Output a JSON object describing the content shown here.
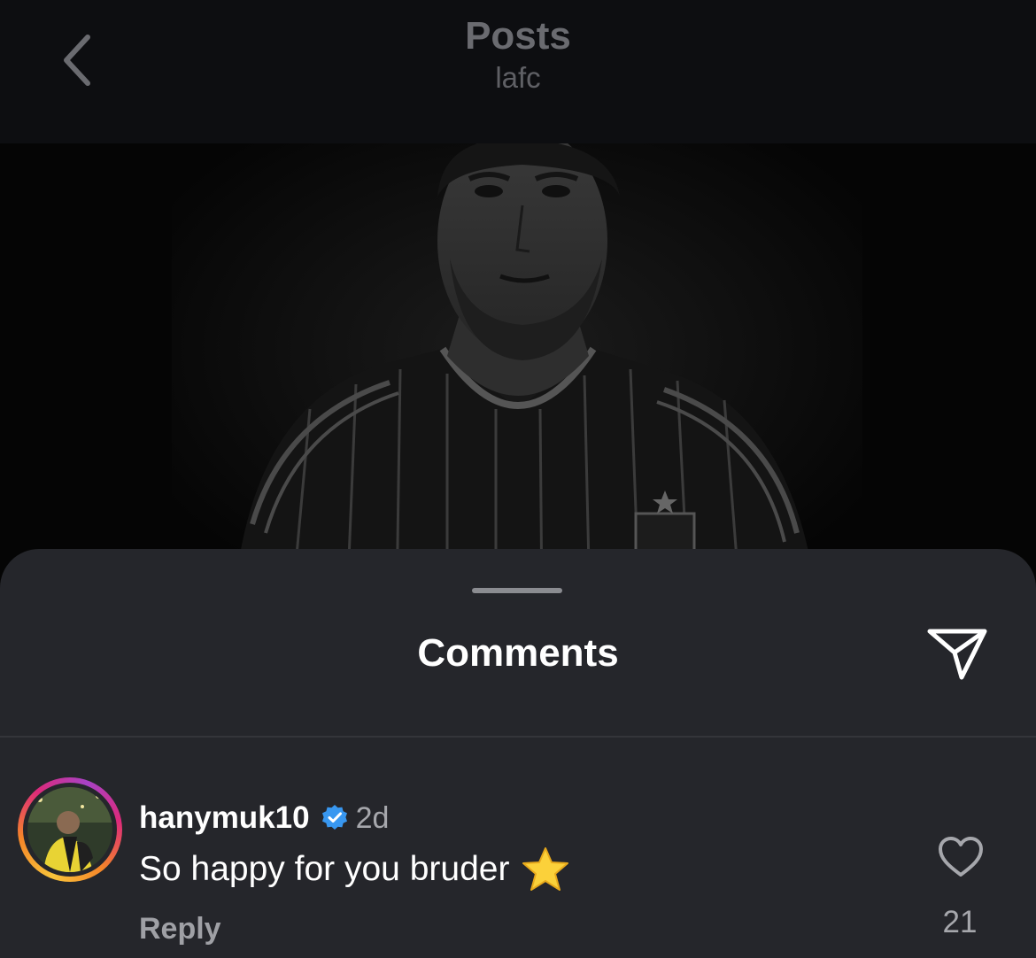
{
  "header": {
    "title": "Posts",
    "subtitle": "lafc",
    "back_icon": "chevron-left-icon"
  },
  "post": {
    "image_description_icon": "player-portrait-image"
  },
  "comments_sheet": {
    "title": "Comments",
    "share_icon": "send-icon",
    "comments": [
      {
        "username": "hanymuk10",
        "verified": true,
        "timestamp": "2d",
        "text": "So happy for you bruder",
        "emoji": "star-emoji",
        "reply_label": "Reply",
        "like_count": "21"
      }
    ]
  },
  "colors": {
    "sheet_background": "#25262b",
    "header_background": "#0d0e11",
    "verified_blue": "#3897f0",
    "muted_text": "#a6a7ac"
  }
}
